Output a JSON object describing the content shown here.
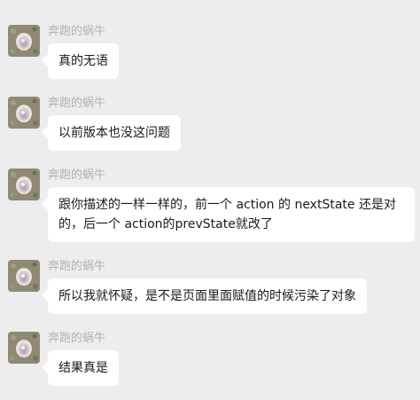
{
  "messages": [
    {
      "sender": "奔跑的蜗牛",
      "avatar_icon": "snail-icon",
      "text": "真的无语"
    },
    {
      "sender": "奔跑的蜗牛",
      "avatar_icon": "snail-icon",
      "text": "以前版本也没这问题"
    },
    {
      "sender": "奔跑的蜗牛",
      "avatar_icon": "snail-icon",
      "text": "跟你描述的一样一样的，前一个 action 的 nextState 还是对的，后一个 action的prevState就改了"
    },
    {
      "sender": "奔跑的蜗牛",
      "avatar_icon": "snail-icon",
      "text": "所以我就怀疑，是不是页面里面赋值的时候污染了对象"
    },
    {
      "sender": "奔跑的蜗牛",
      "avatar_icon": "snail-icon",
      "text": "结果真是"
    }
  ],
  "colors": {
    "background": "#ededed",
    "bubble": "#ffffff",
    "sender_name": "#b2b2b2",
    "message_text": "#1a1a1a"
  }
}
